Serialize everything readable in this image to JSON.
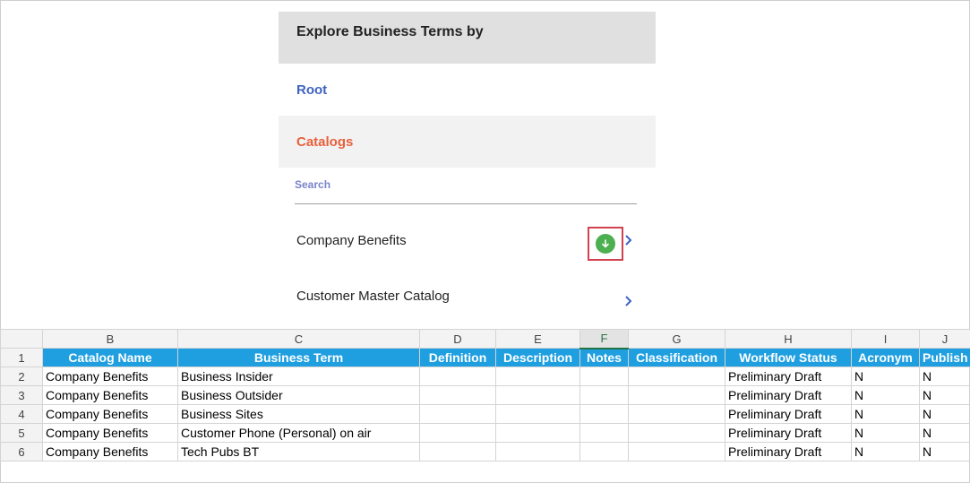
{
  "panel": {
    "header": "Explore Business Terms by",
    "root_label": "Root",
    "catalogs_label": "Catalogs",
    "search_placeholder": "Search",
    "items": [
      {
        "label": "Company Benefits"
      },
      {
        "label": "Customer Master Catalog"
      }
    ]
  },
  "icons": {
    "download": "download-arrow-icon",
    "chevron": "chevron-right-icon"
  },
  "colors": {
    "accent_blue": "#3e63c2",
    "catalogs_orange": "#e8603c",
    "download_green": "#4caf50",
    "highlight_red": "#d2424f",
    "sheet_header_blue": "#1f9fe0"
  },
  "sheet": {
    "columns": [
      "B",
      "C",
      "D",
      "E",
      "F",
      "G",
      "H",
      "I",
      "J"
    ],
    "header_row_number": "1",
    "headers": [
      "Catalog Name",
      "Business Term",
      "Definition",
      "Description",
      "Notes",
      "Classification",
      "Workflow Status",
      "Acronym",
      "Publish"
    ],
    "rows": [
      {
        "n": "2",
        "cells": [
          "Company Benefits",
          "Business Insider",
          "",
          "",
          "",
          "",
          "Preliminary Draft",
          "N",
          "N"
        ]
      },
      {
        "n": "3",
        "cells": [
          "Company Benefits",
          "Business Outsider",
          "",
          "",
          "",
          "",
          "Preliminary Draft",
          "N",
          "N"
        ]
      },
      {
        "n": "4",
        "cells": [
          "Company Benefits",
          "Business Sites",
          "",
          "",
          "",
          "",
          "Preliminary Draft",
          "N",
          "N"
        ]
      },
      {
        "n": "5",
        "cells": [
          "Company Benefits",
          "Customer Phone (Personal) on air",
          "",
          "",
          "",
          "",
          "Preliminary Draft",
          "N",
          "N"
        ]
      },
      {
        "n": "6",
        "cells": [
          "Company Benefits",
          "Tech Pubs BT",
          "",
          "",
          "",
          "",
          "Preliminary Draft",
          "N",
          "N"
        ]
      }
    ]
  }
}
